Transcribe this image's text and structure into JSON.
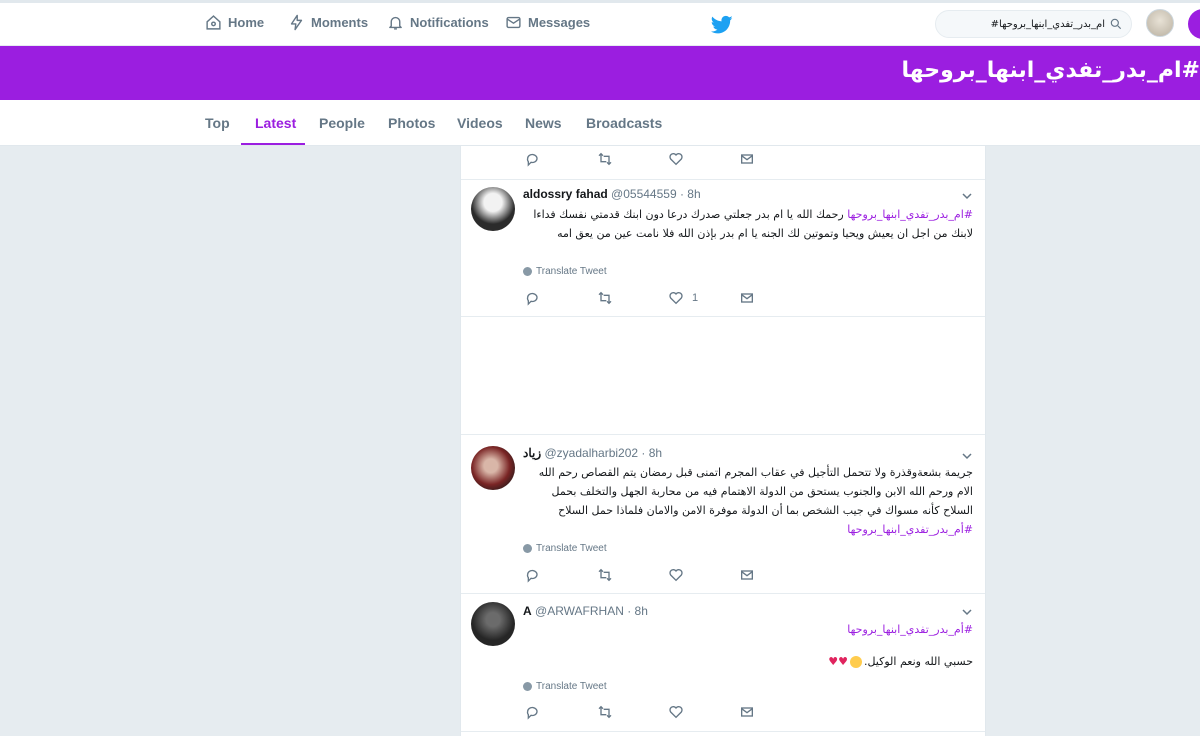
{
  "topnav": {
    "home": "Home",
    "moments": "Moments",
    "notifications": "Notifications",
    "messages": "Messages",
    "search_value": "#ام_بدر_تفدي_ابنها_بروحها"
  },
  "banner": {
    "title": "#ام_بدر_تفدي_ابنها_بروحها"
  },
  "tabs": [
    {
      "label": "Top"
    },
    {
      "label": "Latest"
    },
    {
      "label": "People"
    },
    {
      "label": "Photos"
    },
    {
      "label": "Videos"
    },
    {
      "label": "News"
    },
    {
      "label": "Broadcasts"
    }
  ],
  "tweets": [
    {
      "name": "aldossry fahad",
      "handle": "@05544559",
      "time": "· 8h",
      "hashtag": "#ام_بدر_تفدي_ابنها_بروحها",
      "text": "رحمك الله يا ام بدر جعلتي صدرك درعا دون ابنك قدمتي نفسك فداءا لابنك من اجل ان يعيش ويحيا وتموتين لك الجنه يا ام بدر بإذن الله فلا نامت عين من يعق امه",
      "translate": "Translate Tweet",
      "likes": "1"
    },
    {
      "name": "زياد",
      "handle": "@zyadalharbi202",
      "time": "· 8h",
      "text": "جريمة بشعةوقذرة ولا تتحمل التأجيل في عقاب المجرم اتمنى قبل رمضان يتم القصاص رحم الله الام ورحم الله الابن والجنوب يستحق من الدولة الاهتمام فيه من محاربة الجهل والتخلف بحمل السلاح كأنه مسواك في جيب الشخص بما أن الدولة موفرة الامن والامان فلماذا حمل السلاح",
      "hashtag": "#أم_بدر_تفدي_ابنها_بروحها",
      "translate": "Translate Tweet"
    },
    {
      "name": "A",
      "handle": "@ARWAFRHAN",
      "time": "· 8h",
      "hashtag": "#أم_بدر_تفدي_ابنها_بروحها",
      "text": "حسبي الله ونعم الوكيل.",
      "translate": "Translate Tweet"
    }
  ],
  "colors": {
    "accent": "#9b1ee0",
    "twitter_blue": "#1da1f2"
  }
}
